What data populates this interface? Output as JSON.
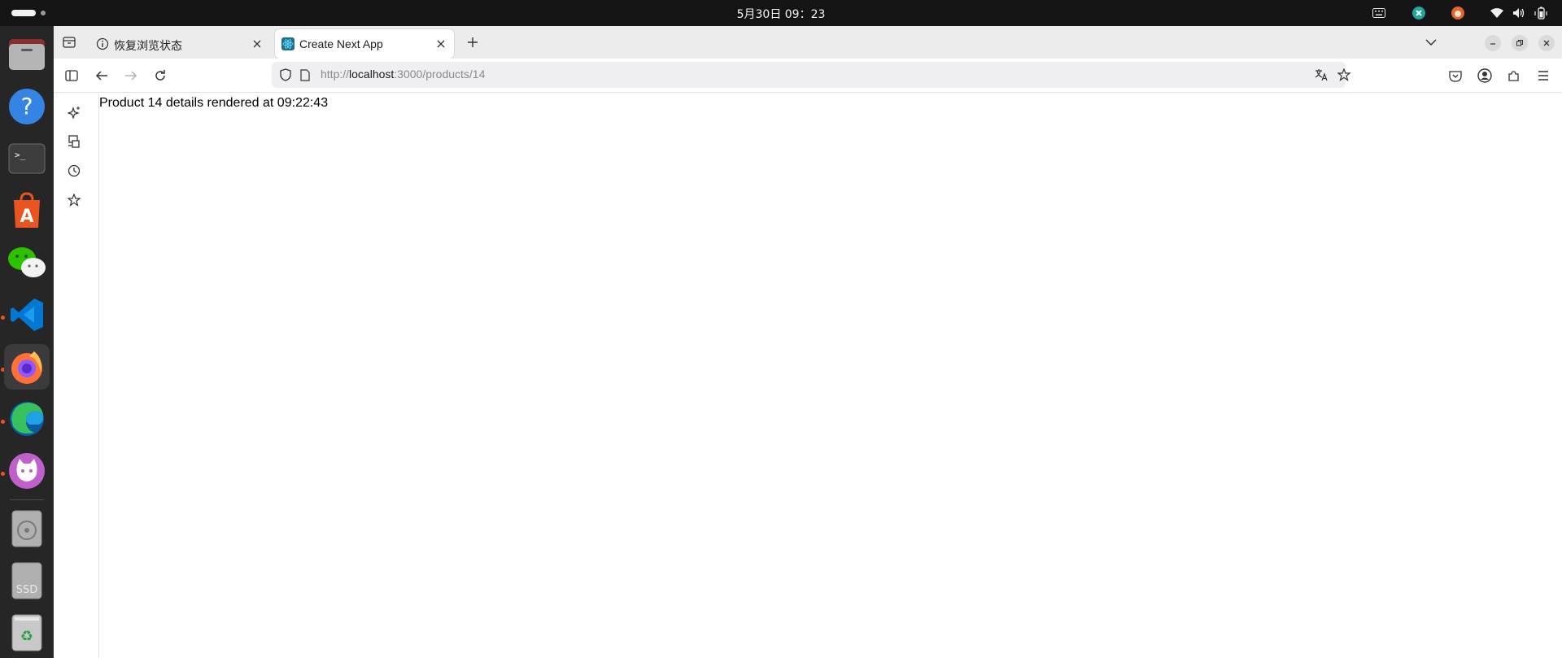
{
  "topbar": {
    "clock": "5月30日  09：23",
    "tray_icons": [
      "keyboard-icon",
      "clash-icon",
      "cat-app-icon",
      "wifi-icon",
      "volume-icon",
      "battery-icon"
    ]
  },
  "dock": {
    "apps": [
      {
        "name": "files",
        "icon": "folder-icon",
        "running": false
      },
      {
        "name": "help",
        "icon": "help-icon",
        "running": false
      },
      {
        "name": "terminal",
        "icon": "terminal-icon",
        "running": false
      },
      {
        "name": "app-center",
        "icon": "app-center-icon",
        "running": false
      },
      {
        "name": "wechat",
        "icon": "wechat-icon",
        "running": false
      },
      {
        "name": "vscode",
        "icon": "vscode-icon",
        "running": true
      },
      {
        "name": "firefox",
        "icon": "firefox-icon",
        "running": true,
        "active": true
      },
      {
        "name": "edge",
        "icon": "edge-icon",
        "running": true
      },
      {
        "name": "cat-app",
        "icon": "cat-app-icon",
        "running": true
      },
      {
        "name": "disc",
        "icon": "disc-icon",
        "running": false
      },
      {
        "name": "ssd",
        "icon": "ssd-drive-icon",
        "label": "SSD",
        "running": false
      },
      {
        "name": "trash",
        "icon": "trash-icon",
        "running": false
      }
    ]
  },
  "browser": {
    "tabs": [
      {
        "title": "恢复浏览状态",
        "icon": "info-icon",
        "active": false
      },
      {
        "title": "Create Next App",
        "icon": "react-icon",
        "active": true
      }
    ],
    "url": {
      "prefix": "http://",
      "host": "localhost",
      "rest": ":3000/products/14"
    },
    "content": {
      "text": "Product 14 details rendered at 09:22:43"
    }
  },
  "colors": {
    "topbar_bg": "#141414",
    "dock_bg": "#262626",
    "tabbar_bg": "#ececec",
    "urlbar_bg": "#efeff1",
    "accent_orange": "#e95420"
  }
}
